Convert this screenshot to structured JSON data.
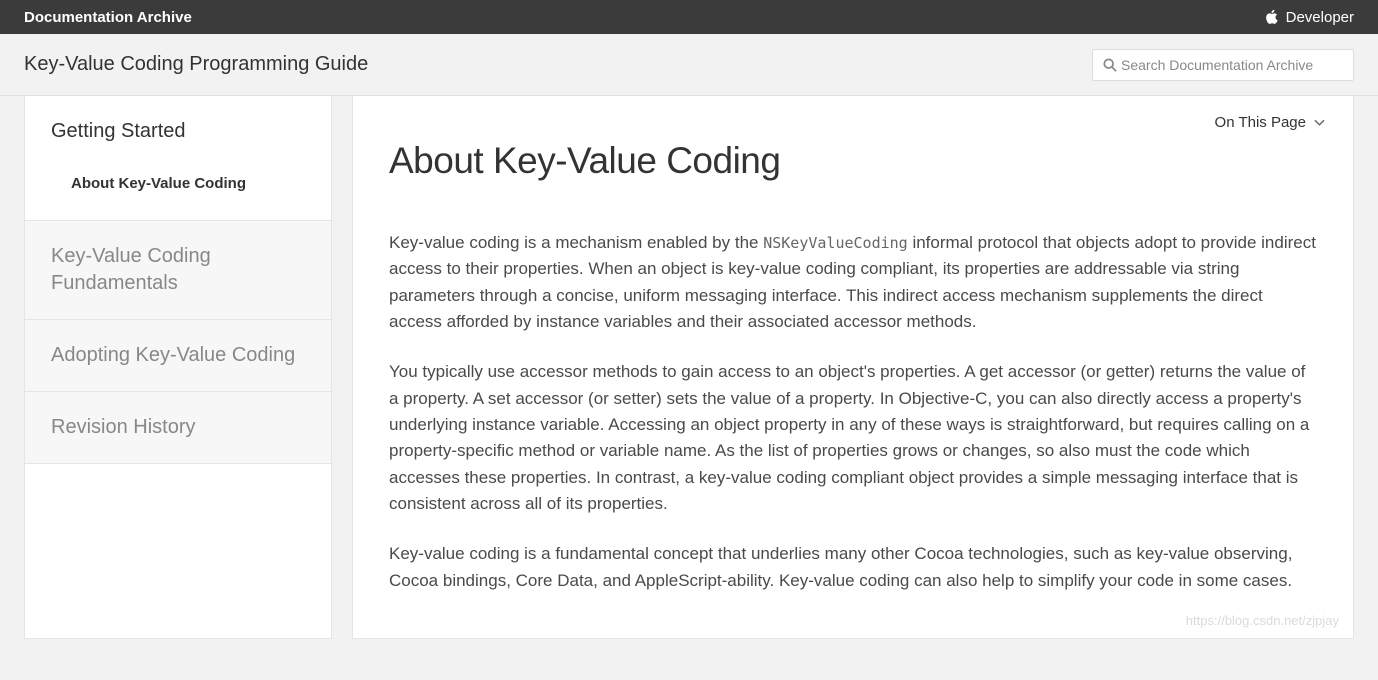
{
  "topbar": {
    "left": "Documentation Archive",
    "right": "Developer"
  },
  "subheader": {
    "title": "Key-Value Coding Programming Guide",
    "search_placeholder": "Search Documentation Archive"
  },
  "sidebar": {
    "sections": [
      {
        "title": "Getting Started",
        "active": true,
        "sub": "About Key-Value Coding"
      },
      {
        "title": "Key-Value Coding Fundamentals",
        "active": false
      },
      {
        "title": "Adopting Key-Value Coding",
        "active": false
      },
      {
        "title": "Revision History",
        "active": false
      }
    ]
  },
  "main": {
    "on_this_page": "On This Page",
    "title": "About Key-Value Coding",
    "para1_a": "Key-value coding is a mechanism enabled by the ",
    "para1_code": "NSKeyValueCoding",
    "para1_b": " informal protocol that objects adopt to provide indirect access to their properties. When an object is key-value coding compliant, its properties are addressable via string parameters through a concise, uniform messaging interface. This indirect access mechanism supplements the direct access afforded by instance variables and their associated accessor methods.",
    "para2": "You typically use accessor methods to gain access to an object's properties. A get accessor (or getter) returns the value of a property. A set accessor (or setter) sets the value of a property. In Objective-C, you can also directly access a property's underlying instance variable. Accessing an object property in any of these ways is straightforward, but requires calling on a property-specific method or variable name. As the list of properties grows or changes, so also must the code which accesses these properties. In contrast, a key-value coding compliant object provides a simple messaging interface that is consistent across all of its properties.",
    "para3": "Key-value coding is a fundamental concept that underlies many other Cocoa technologies, such as key-value observing, Cocoa bindings, Core Data, and AppleScript-ability. Key-value coding can also help to simplify your code in some cases."
  },
  "watermark": "https://blog.csdn.net/zjpjay"
}
